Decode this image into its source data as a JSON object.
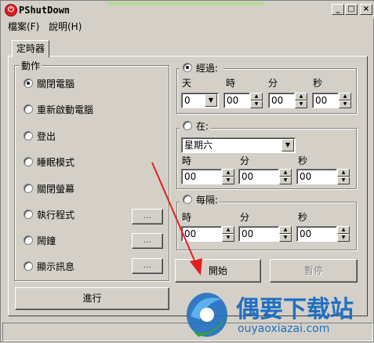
{
  "window": {
    "title": "PShutDown",
    "app_icon": "power-icon"
  },
  "caption_buttons": {
    "minimize": "_",
    "maximize": "□",
    "close": "×"
  },
  "menu": {
    "items": [
      {
        "label": "檔案(F)"
      },
      {
        "label": "說明(H)"
      }
    ]
  },
  "tabs": [
    {
      "label": "定時器",
      "selected": true
    }
  ],
  "actions": {
    "legend": "動作",
    "options": [
      {
        "label": "關閉電腦",
        "checked": true
      },
      {
        "label": "重新啟動電腦",
        "checked": false
      },
      {
        "label": "登出",
        "checked": false
      },
      {
        "label": "睡眠模式",
        "checked": false
      },
      {
        "label": "關閉螢幕",
        "checked": false
      },
      {
        "label": "執行程式",
        "checked": false,
        "browse": "..."
      },
      {
        "label": "鬧鐘",
        "checked": false,
        "browse": "..."
      },
      {
        "label": "顯示訊息",
        "checked": false,
        "browse": "..."
      }
    ],
    "run_button": "進行"
  },
  "timer": {
    "elapsed": {
      "label": "經過:",
      "checked": true,
      "labels": {
        "day": "天",
        "hour": "時",
        "minute": "分",
        "second": "秒"
      },
      "values": {
        "day": "0",
        "hour": "00",
        "minute": "00",
        "second": "00"
      }
    },
    "at": {
      "label": "在:",
      "checked": false,
      "weekday": "星期六",
      "labels": {
        "hour": "時",
        "minute": "分",
        "second": "秒"
      },
      "values": {
        "hour": "00",
        "minute": "00",
        "second": "00"
      }
    },
    "every": {
      "label": "每隔:",
      "checked": false,
      "labels": {
        "hour": "時",
        "minute": "分",
        "second": "秒"
      },
      "values": {
        "hour": "00",
        "minute": "00",
        "second": "00"
      }
    },
    "start_button": "開始",
    "pause_button": "暫停"
  },
  "watermark": {
    "brand": "偶要下载站",
    "url": "ouyaoxiazai.com",
    "accent": "#1f6fc0"
  }
}
